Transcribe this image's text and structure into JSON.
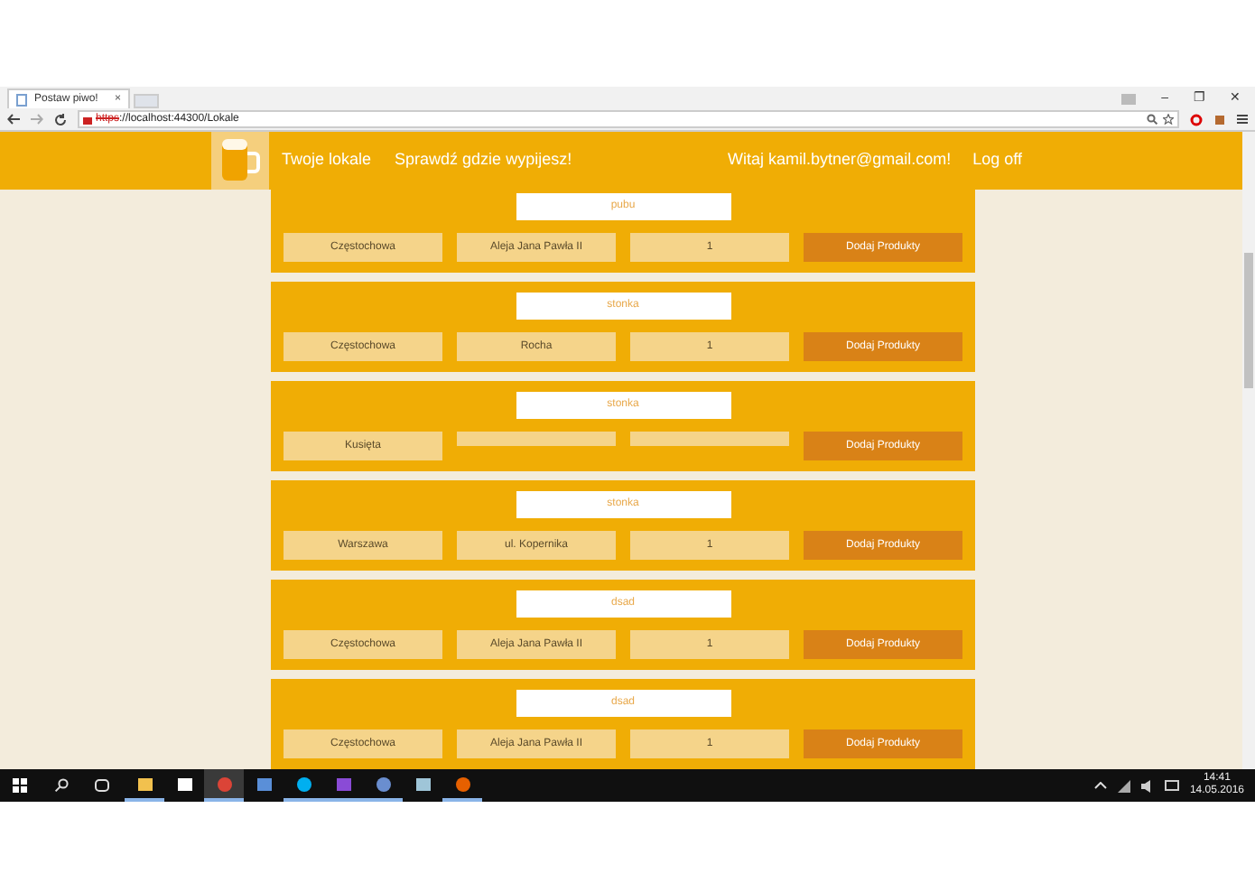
{
  "browser": {
    "tab_title": "Postaw piwo!",
    "tab_close": "×",
    "url_scheme": "https",
    "url_rest": "://localhost:44300/Lokale",
    "window_controls": [
      "–",
      "❐",
      "✕"
    ]
  },
  "navbar": {
    "links": [
      "Twoje lokale",
      "Sprawdź gdzie wypijesz!"
    ],
    "greeting": "Witaj kamil.bytner@gmail.com!",
    "logoff": "Log off"
  },
  "venues": [
    {
      "name": "pubu",
      "city": "Częstochowa",
      "street": "Aleja Jana Pawła II",
      "number": "1",
      "action": "Dodaj Produkty"
    },
    {
      "name": "stonka",
      "city": "Częstochowa",
      "street": "Rocha",
      "number": "1",
      "action": "Dodaj Produkty"
    },
    {
      "name": "stonka",
      "city": "Kusięta",
      "action": "Dodaj Produkty"
    },
    {
      "name": "stonka",
      "city": "Warszawa",
      "street": "ul. Kopernika",
      "number": "1",
      "action": "Dodaj Produkty"
    },
    {
      "name": "dsad",
      "city": "Częstochowa",
      "street": "Aleja Jana Pawła II",
      "number": "1",
      "action": "Dodaj Produkty"
    },
    {
      "name": "dsad",
      "city": "Częstochowa",
      "street": "Aleja Jana Pawła II",
      "number": "1",
      "action": "Dodaj Produkty"
    }
  ],
  "taskbar": {
    "apps": [
      {
        "kind": "explorer",
        "open": true,
        "selected": false
      },
      {
        "kind": "store",
        "open": false,
        "selected": false
      },
      {
        "kind": "chrome",
        "open": true,
        "selected": true
      },
      {
        "kind": "remote",
        "open": false,
        "selected": false
      },
      {
        "kind": "skype",
        "open": true,
        "selected": false
      },
      {
        "kind": "vs",
        "open": true,
        "selected": false
      },
      {
        "kind": "globe",
        "open": true,
        "selected": false
      },
      {
        "kind": "notes",
        "open": false,
        "selected": false
      },
      {
        "kind": "firefox",
        "open": true,
        "selected": false
      }
    ],
    "time": "14:41",
    "date": "14.05.2016"
  }
}
